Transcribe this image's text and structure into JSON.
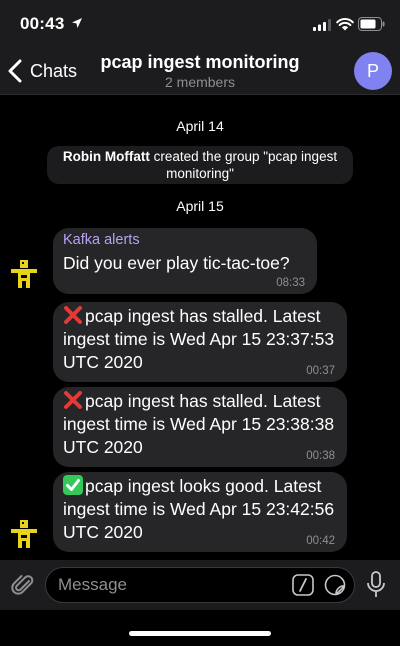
{
  "status": {
    "time": "00:43"
  },
  "header": {
    "back_label": "Chats",
    "title": "pcap ingest monitoring",
    "subtitle": "2 members",
    "avatar_letter": "P"
  },
  "messages": {
    "date1": "April 14",
    "service_name": "Robin Moffatt",
    "service_text": " created the group \"pcap ingest monitoring\"",
    "date2": "April 15",
    "m1_sender": "Kafka alerts",
    "m1_text": "Did you ever play tic-tac-toe?",
    "m1_time": "08:33",
    "m2_text": "pcap ingest has stalled. Latest ingest time is  Wed Apr 15 23:37:53 UTC 2020",
    "m2_time": "00:37",
    "m3_text": "pcap ingest has stalled. Latest ingest time is  Wed Apr 15 23:38:38 UTC 2020",
    "m3_time": "00:38",
    "m4_text": "pcap ingest looks good. Latest ingest time is  Wed Apr 15 23:42:56 UTC 2020",
    "m4_time": "00:42"
  },
  "input": {
    "placeholder": "Message"
  },
  "colors": {
    "accent": "#7f82f0",
    "sender": "#b8a1f5",
    "bubble": "#262628",
    "ok": "#34c759",
    "error": "#e53935"
  },
  "icons": [
    "location-arrow-icon",
    "signal-icon",
    "wifi-icon",
    "battery-icon",
    "back-chevron-icon",
    "bot-avatar-icon",
    "cross-mark-icon",
    "check-mark-icon",
    "paperclip-icon",
    "command-icon",
    "sticker-icon",
    "microphone-icon"
  ]
}
